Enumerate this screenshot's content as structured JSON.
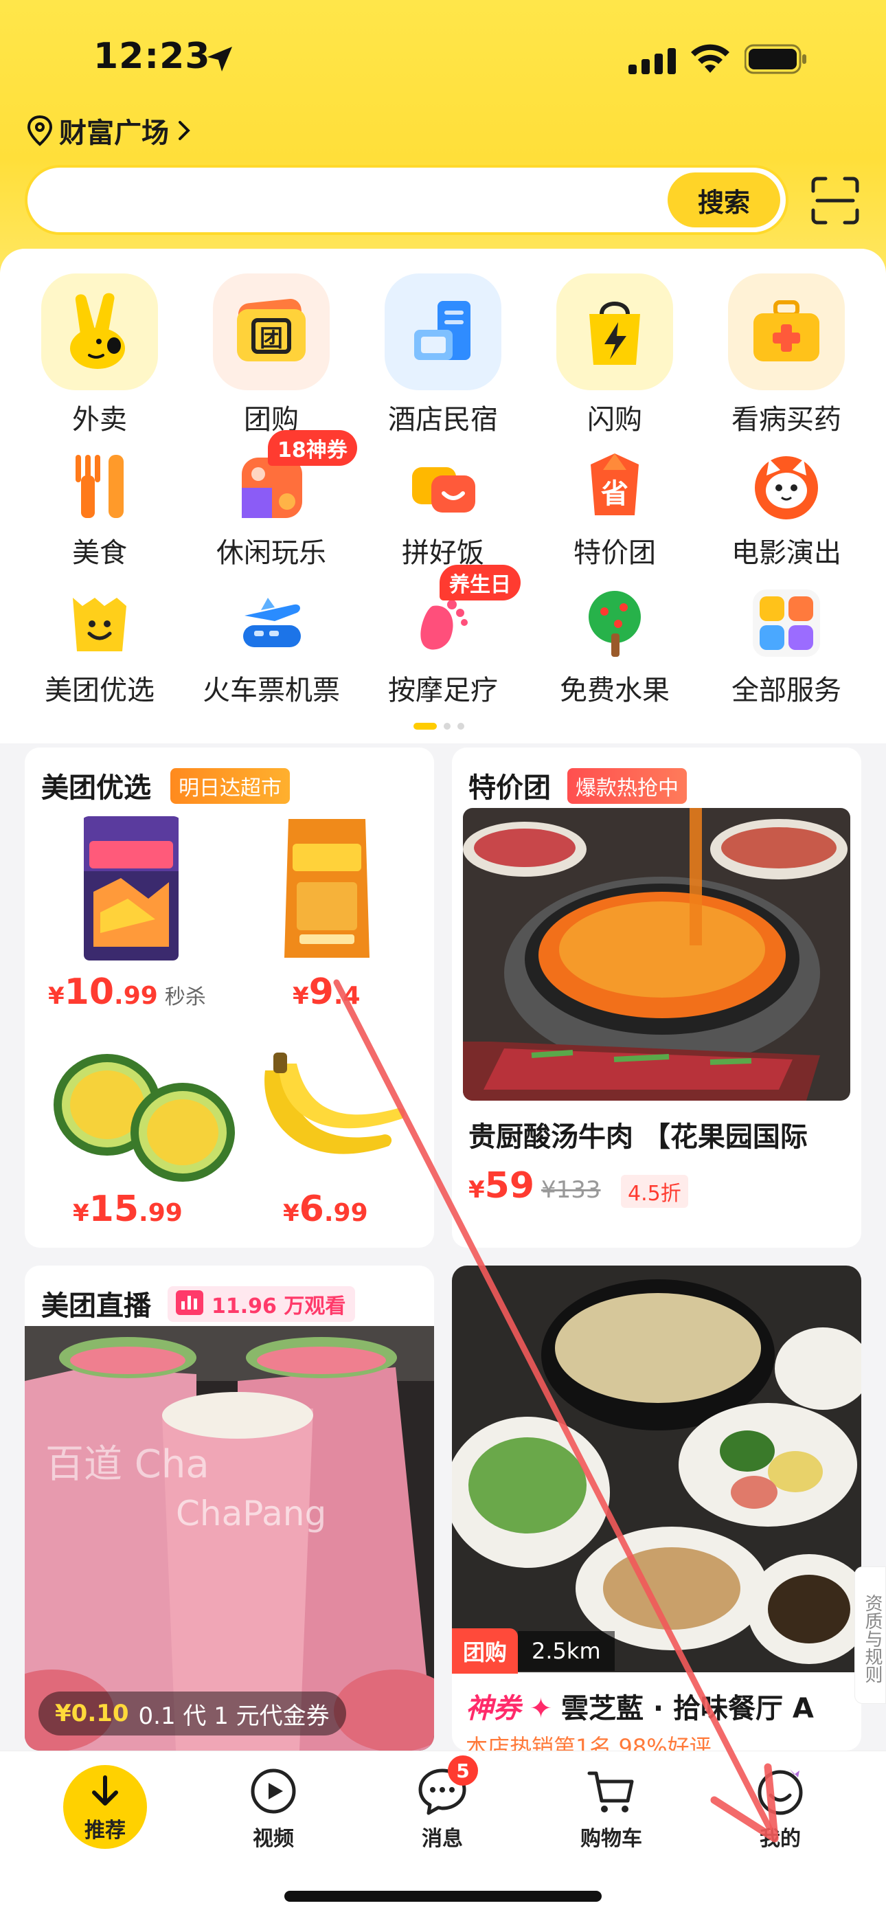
{
  "status": {
    "time": "12:23"
  },
  "header": {
    "location": "财富广场",
    "search_placeholder": "",
    "search_button": "搜索"
  },
  "services": {
    "row1": [
      {
        "label": "外卖",
        "icon": "delivery-bunny-icon"
      },
      {
        "label": "团购",
        "icon": "group-buy-ticket-icon"
      },
      {
        "label": "酒店民宿",
        "icon": "hotel-building-icon"
      },
      {
        "label": "闪购",
        "icon": "flash-bag-icon"
      },
      {
        "label": "看病买药",
        "icon": "medicine-kit-icon"
      }
    ],
    "row2": [
      {
        "label": "美食",
        "icon": "fork-knife-icon"
      },
      {
        "label": "休闲玩乐",
        "icon": "leisure-grid-icon",
        "badge": "18神券"
      },
      {
        "label": "拼好饭",
        "icon": "group-meal-icon"
      },
      {
        "label": "特价团",
        "icon": "discount-shield-icon"
      },
      {
        "label": "电影演出",
        "icon": "movie-cat-icon"
      }
    ],
    "row3": [
      {
        "label": "美团优选",
        "icon": "smiley-bag-icon"
      },
      {
        "label": "火车票机票",
        "icon": "plane-train-icon"
      },
      {
        "label": "按摩足疗",
        "icon": "foot-icon",
        "badge": "养生日"
      },
      {
        "label": "免费水果",
        "icon": "fruit-tree-icon"
      },
      {
        "label": "全部服务",
        "icon": "all-services-grid-icon"
      }
    ]
  },
  "cards": {
    "youxuan": {
      "title": "美团优选",
      "tag": "明日达超市",
      "items": [
        {
          "yen": "¥",
          "int": "10",
          "dec": ".99",
          "note": "秒杀"
        },
        {
          "yen": "¥",
          "int": "9",
          "dec": ".4",
          "note": ""
        },
        {
          "yen": "¥",
          "int": "15",
          "dec": ".99",
          "note": ""
        },
        {
          "yen": "¥",
          "int": "6",
          "dec": ".99",
          "note": ""
        }
      ]
    },
    "tejia": {
      "title": "特价团",
      "tag": "爆款热抢中",
      "deal_title": "贵厨酸汤牛肉 【花果园国际",
      "price_yen": "¥",
      "price": "59",
      "orig_price": "¥133",
      "discount": "4.5折"
    },
    "live": {
      "title": "美团直播",
      "viewers": "11.96 万观看",
      "promo_price": "¥0.10",
      "promo_text": "0.1 代 1 元代金券"
    },
    "tuangou": {
      "tag": "团购",
      "distance": "2.5km",
      "brand": "神券",
      "shop": "雲芝藍 · 拾味餐厅 A",
      "sub": "本店热销第1名  98%好评"
    }
  },
  "side_label": "资质与规则",
  "tabbar": {
    "home": "推荐",
    "video": "视频",
    "messages": "消息",
    "messages_badge": "5",
    "cart": "购物车",
    "me": "我的"
  },
  "colors": {
    "brand_yellow": "#ffd100",
    "price_red": "#ff3b30",
    "annotation_arrow": "#f25a5a"
  }
}
